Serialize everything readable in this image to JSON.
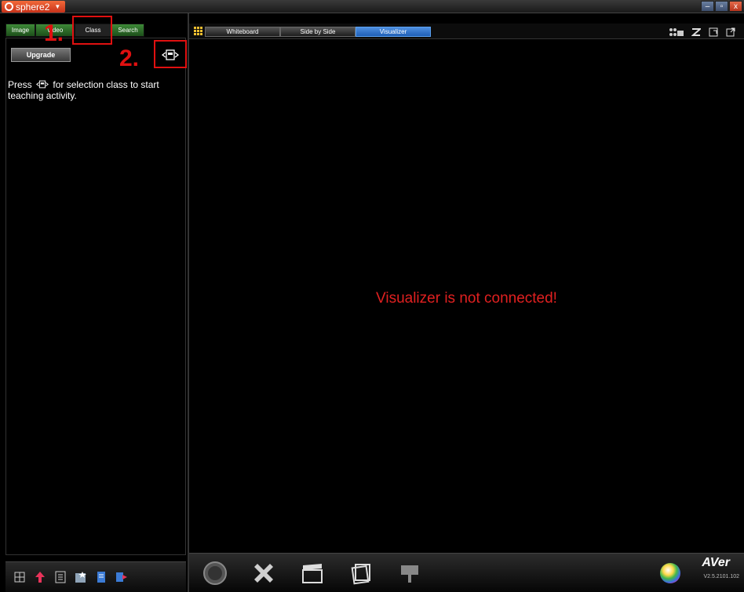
{
  "titlebar": {
    "app_name": "sphere2",
    "minimize_label": "–",
    "restore_label": "▫",
    "close_label": "x"
  },
  "left": {
    "tabs": [
      {
        "label": "Image"
      },
      {
        "label": "Video"
      },
      {
        "label": "Class"
      },
      {
        "label": "Search"
      }
    ],
    "upgrade_label": "Upgrade",
    "help_text_before": "Press",
    "help_text_after": "for selection class to start teaching activity."
  },
  "annotations": {
    "one": "1.",
    "two": "2."
  },
  "right": {
    "modes": [
      {
        "label": "Whiteboard"
      },
      {
        "label": "Side by Side"
      },
      {
        "label": "Visualizer"
      }
    ],
    "message": "Visualizer is not connected!",
    "brand": "AVer",
    "version": "V2.5.2101.102"
  },
  "colors": {
    "accent_blue": "#2f74cf",
    "tab_green": "#2d6d28",
    "alert_red": "#e02020"
  }
}
